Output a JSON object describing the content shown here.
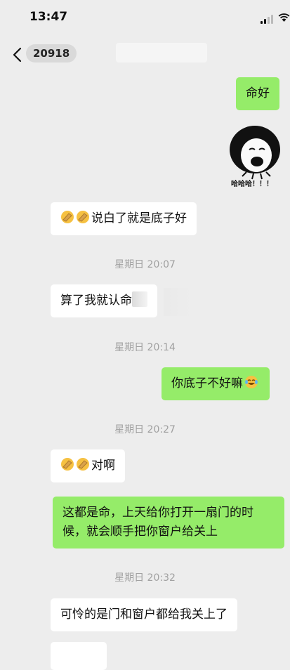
{
  "status_bar": {
    "time": "13:47"
  },
  "nav": {
    "unread_count": "20918"
  },
  "messages": [
    {
      "id": "m1",
      "side": "out",
      "text": "命好"
    },
    {
      "id": "m2",
      "side": "out",
      "type": "sticker",
      "caption": "哈哈哈！！！"
    },
    {
      "id": "m3",
      "side": "in",
      "emojis": 2,
      "text": "说白了就是底子好"
    },
    {
      "id": "t1",
      "type": "timestamp",
      "text": "星期日 20:07"
    },
    {
      "id": "m4",
      "side": "in",
      "text": "算了我就认命"
    },
    {
      "id": "t2",
      "type": "timestamp",
      "text": "星期日 20:14"
    },
    {
      "id": "m5",
      "side": "out",
      "text": "你底子不好嘛"
    },
    {
      "id": "t3",
      "type": "timestamp",
      "text": "星期日 20:27"
    },
    {
      "id": "m6",
      "side": "in",
      "emojis": 2,
      "text": "对啊"
    },
    {
      "id": "m7",
      "side": "out",
      "text": "这都是命，上天给你打开一扇门的时候，就会顺手把你窗户给关上"
    },
    {
      "id": "t4",
      "type": "timestamp",
      "text": "星期日 20:32"
    },
    {
      "id": "m8",
      "side": "in",
      "text": "可怜的是门和窗户都给我关上了"
    }
  ],
  "colors": {
    "background": "#ededed",
    "incoming": "#ffffff",
    "outgoing": "#95ec69",
    "timestamp": "#a0a0a0"
  }
}
